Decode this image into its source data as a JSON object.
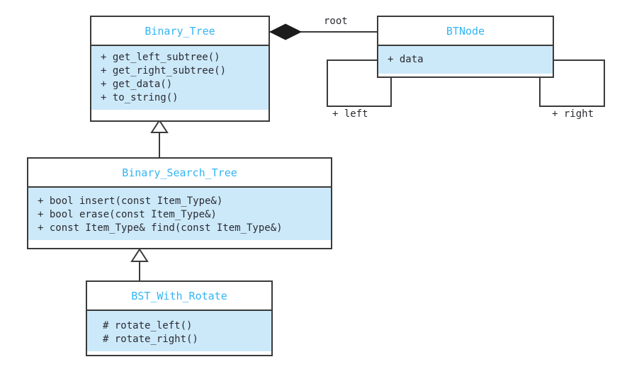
{
  "diagram": {
    "kind": "uml-class-diagram",
    "colors": {
      "title_text": "#33b5f5",
      "body_fill": "#cce9f9",
      "header_fill": "#ffffff",
      "border": "#3a3a3a",
      "member_text": "#2b2b33",
      "background": "#ffffff"
    }
  },
  "classes": {
    "binary_tree": {
      "name": "Binary_Tree",
      "members": [
        "+ get_left_subtree()",
        "+ get_right_subtree()",
        "+ get_data()",
        "+ to_string()"
      ]
    },
    "btnode": {
      "name": "BTNode",
      "members": [
        "+ data"
      ]
    },
    "binary_search_tree": {
      "name": "Binary_Search_Tree",
      "members": [
        "+ bool insert(const Item_Type&)",
        "+ bool erase(const Item_Type&)",
        "+ const Item_Type& find(const Item_Type&)"
      ]
    },
    "bst_with_rotate": {
      "name": "BST_With_Rotate",
      "members": [
        "# rotate_left()",
        "# rotate_right()"
      ]
    }
  },
  "relationships": {
    "composition_root": {
      "label": "root",
      "from": "Binary_Tree",
      "to": "BTNode",
      "type": "composition"
    },
    "self_left": {
      "label": "+ left",
      "on": "BTNode",
      "type": "association"
    },
    "self_right": {
      "label": "+ right",
      "on": "BTNode",
      "type": "association"
    },
    "generalization_bst": {
      "from": "Binary_Search_Tree",
      "to": "Binary_Tree",
      "type": "generalization"
    },
    "generalization_rotate": {
      "from": "BST_With_Rotate",
      "to": "Binary_Search_Tree",
      "type": "generalization"
    }
  }
}
